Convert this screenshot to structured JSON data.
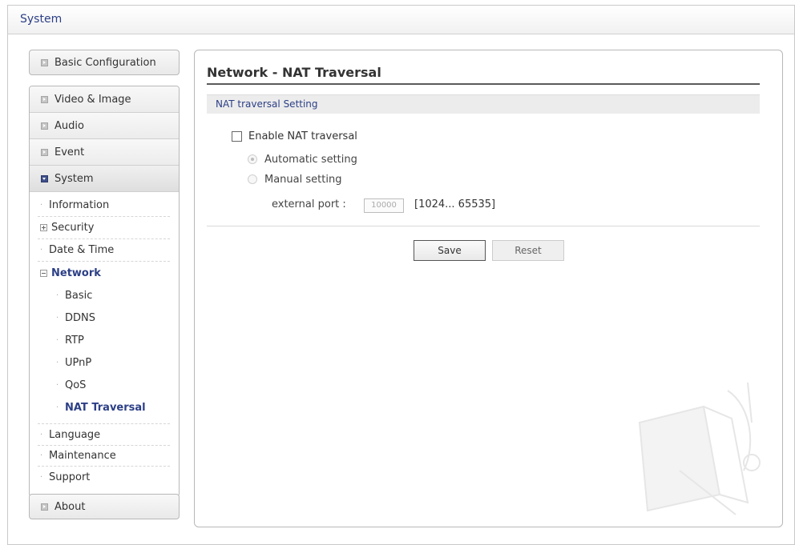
{
  "header": {
    "title": "System"
  },
  "sidebar": {
    "basic_configuration": "Basic Configuration",
    "video_image": "Video & Image",
    "audio": "Audio",
    "event": "Event",
    "system": "System",
    "information": "Information",
    "security": "Security",
    "date_time": "Date & Time",
    "network": "Network",
    "basic": "Basic",
    "ddns": "DDNS",
    "rtp": "RTP",
    "upnp": "UPnP",
    "qos": "QoS",
    "nat_traversal": "NAT Traversal",
    "language": "Language",
    "maintenance": "Maintenance",
    "support": "Support",
    "about": "About"
  },
  "main": {
    "title": "Network - NAT Traversal",
    "section": "NAT traversal Setting",
    "enable_label": "Enable NAT traversal",
    "enable_checked": false,
    "auto_label": "Automatic setting",
    "manual_label": "Manual setting",
    "selected_mode": "Automatic setting",
    "external_port_label": "external port :",
    "external_port_value": "10000",
    "port_range": "[1024... 65535]",
    "save_label": "Save",
    "reset_label": "Reset"
  },
  "colors": {
    "accent": "#2c3f86",
    "section_bg": "#ececec"
  }
}
